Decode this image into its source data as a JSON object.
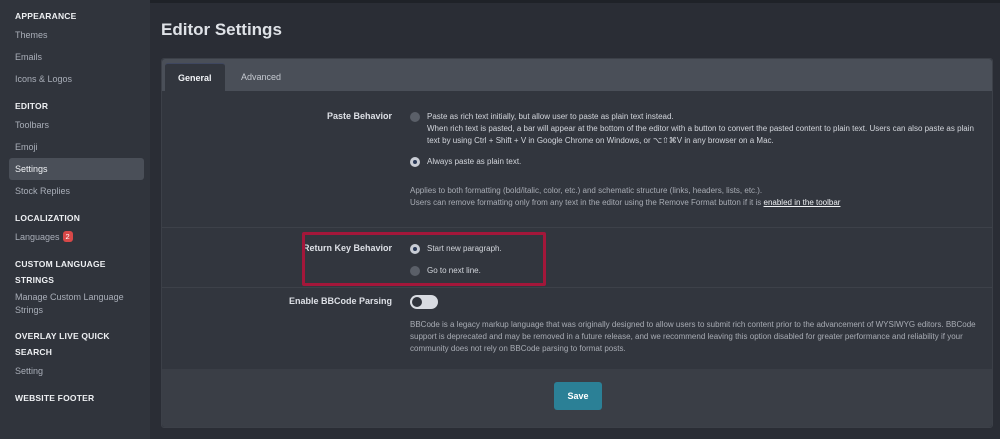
{
  "sidebar": {
    "sections": [
      {
        "heading": "APPEARANCE",
        "items": [
          "Themes",
          "Emails",
          "Icons & Logos"
        ]
      },
      {
        "heading": "EDITOR",
        "items": [
          "Toolbars",
          "Emoji",
          "Settings",
          "Stock Replies"
        ]
      },
      {
        "heading": "LOCALIZATION",
        "items": [
          "Languages"
        ]
      },
      {
        "heading": "CUSTOM LANGUAGE STRINGS",
        "items": [
          "Manage Custom Language Strings"
        ]
      },
      {
        "heading": "OVERLAY LIVE QUICK SEARCH",
        "items": [
          "Setting"
        ]
      },
      {
        "heading": "WEBSITE FOOTER",
        "items": []
      }
    ],
    "languages_badge": "2",
    "active_item": "Settings"
  },
  "page": {
    "title": "Editor Settings"
  },
  "tabs": [
    {
      "label": "General",
      "active": true
    },
    {
      "label": "Advanced",
      "active": false
    }
  ],
  "paste_behavior": {
    "label": "Paste Behavior",
    "option1": "Paste as rich text initially, but allow user to paste as plain text instead.",
    "option1_desc": "When rich text is pasted, a bar will appear at the bottom of the editor with a button to convert the pasted content to plain text. Users can also paste as plain text by using Ctrl + Shift + V in Google Chrome on Windows, or ⌥⇧⌘V in any browser on a Mac.",
    "option2": "Always paste as plain text.",
    "selected": 2,
    "note1": "Applies to both formatting (bold/italic, color, etc.) and schematic structure (links, headers, lists, etc.).",
    "note2": "Users can remove formatting only from any text in the editor using the Remove Format button if it is",
    "note_link": "enabled in the toolbar"
  },
  "return_key": {
    "label": "Return Key Behavior",
    "option1": "Start new paragraph.",
    "option2": "Go to next line.",
    "selected": 1
  },
  "bbcode": {
    "label": "Enable BBCode Parsing",
    "enabled": false,
    "description": "BBCode is a legacy markup language that was originally designed to allow users to submit rich content prior to the advancement of WYSIWYG editors. BBCode support is deprecated and may be removed in a future release, and we recommend leaving this option disabled for greater performance and reliability if your community does not rely on BBCode parsing to format posts."
  },
  "footer": {
    "save_label": "Save"
  },
  "colors": {
    "accent": "#2b8096",
    "highlight_border": "#a3173a",
    "badge": "#d74848"
  }
}
